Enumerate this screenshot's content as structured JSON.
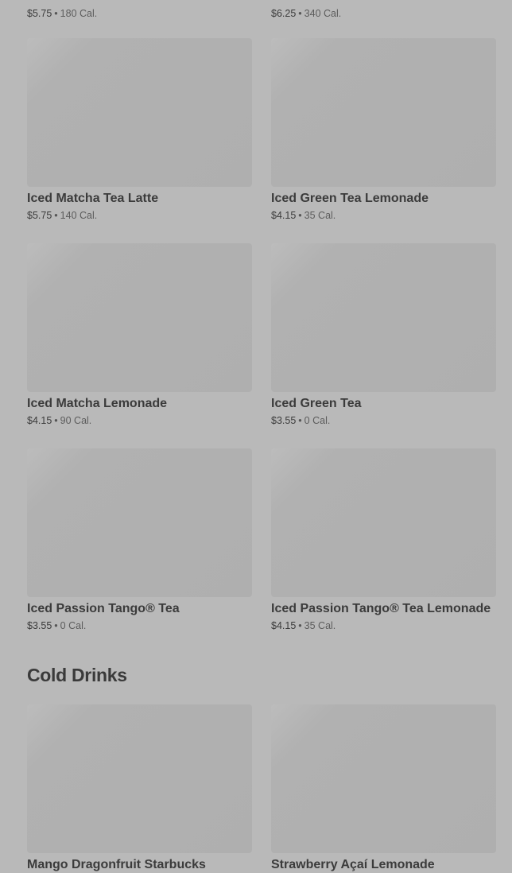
{
  "top_partial": [
    {
      "price": "$5.75",
      "cal": "180 Cal."
    },
    {
      "price": "$6.25",
      "cal": "340 Cal."
    }
  ],
  "iced_tea_items": [
    {
      "name": "Iced Matcha Tea Latte",
      "price": "$5.75",
      "cal": "140 Cal."
    },
    {
      "name": "Iced Green Tea Lemonade",
      "price": "$4.15",
      "cal": "35 Cal."
    },
    {
      "name": "Iced Matcha Lemonade",
      "price": "$4.15",
      "cal": "90 Cal."
    },
    {
      "name": "Iced Green Tea",
      "price": "$3.55",
      "cal": "0 Cal."
    },
    {
      "name": "Iced Passion Tango® Tea",
      "price": "$3.55",
      "cal": "0 Cal."
    },
    {
      "name": "Iced Passion Tango® Tea Lemonade",
      "price": "$4.15",
      "cal": "35 Cal."
    }
  ],
  "cold_drinks": {
    "title": "Cold Drinks",
    "items": [
      {
        "name": "Mango Dragonfruit Starbucks"
      },
      {
        "name": "Strawberry Açaí Lemonade"
      }
    ]
  },
  "separator": "•"
}
